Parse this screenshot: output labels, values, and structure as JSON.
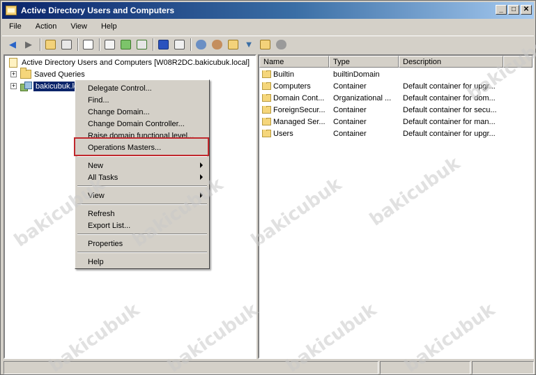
{
  "window": {
    "title": "Active Directory Users and Computers"
  },
  "title_buttons": [
    "_",
    "□",
    "✕"
  ],
  "menu": [
    "File",
    "Action",
    "View",
    "Help"
  ],
  "tree": {
    "root": "Active Directory Users and Computers [W08R2DC.bakicubuk.local]",
    "saved_queries": "Saved Queries",
    "domain": "bakicubuk.local",
    "expander": "+"
  },
  "list": {
    "headers": [
      "Name",
      "Type",
      "Description"
    ],
    "rows": [
      {
        "name": "Builtin",
        "type": "builtinDomain",
        "description": ""
      },
      {
        "name": "Computers",
        "type": "Container",
        "description": "Default container for upgr..."
      },
      {
        "name": "Domain Cont...",
        "type": "Organizational ...",
        "description": "Default container for dom..."
      },
      {
        "name": "ForeignSecur...",
        "type": "Container",
        "description": "Default container for secu..."
      },
      {
        "name": "Managed Ser...",
        "type": "Container",
        "description": "Default container for man..."
      },
      {
        "name": "Users",
        "type": "Container",
        "description": "Default container for upgr..."
      }
    ]
  },
  "context_menu": {
    "delegate": "Delegate Control...",
    "find": "Find...",
    "change_domain": "Change Domain...",
    "change_dc": "Change Domain Controller...",
    "raise": "Raise domain functional level...",
    "operations_masters": "Operations Masters...",
    "new": "New",
    "all_tasks": "All Tasks",
    "view": "View",
    "refresh": "Refresh",
    "export": "Export List...",
    "properties": "Properties",
    "help": "Help"
  },
  "watermark": "bakicubuk",
  "colors": {
    "title_start": "#0a246a",
    "title_end": "#a6caf0",
    "selection": "#0a246a",
    "highlight_box": "#c0282d"
  }
}
